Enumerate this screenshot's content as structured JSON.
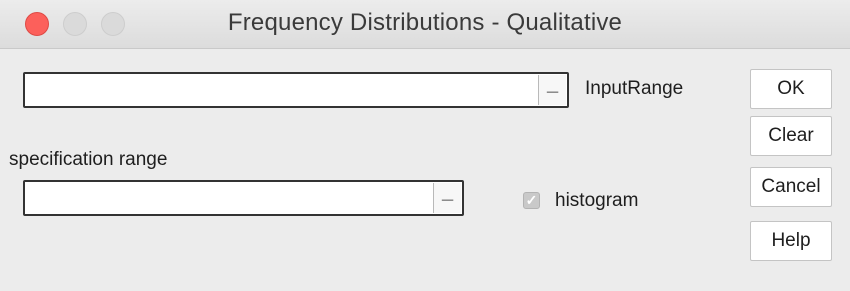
{
  "window": {
    "title": "Frequency Distributions - Qualitative"
  },
  "input_range": {
    "label": "InputRange",
    "value": "",
    "picker_glyph": "_"
  },
  "specification_range": {
    "label": "specification range",
    "value": "",
    "picker_glyph": "_"
  },
  "histogram": {
    "label": "histogram",
    "checked": true,
    "check_glyph": "✓",
    "disabled": true
  },
  "buttons": {
    "ok": "OK",
    "clear": "Clear",
    "cancel": "Cancel",
    "help": "Help"
  },
  "colors": {
    "close": "#fc605b",
    "inactive_traffic": "#dadada",
    "window_bg": "#ececec"
  }
}
